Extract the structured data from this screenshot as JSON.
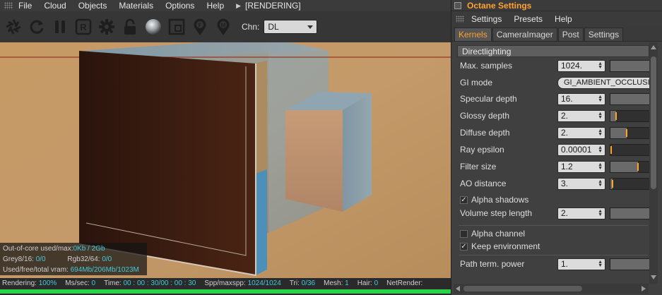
{
  "viewer": {
    "menu": [
      "File",
      "Cloud",
      "Objects",
      "Materials",
      "Options",
      "Help"
    ],
    "rendering_label": "[RENDERING]",
    "toolbar_icons": [
      "aperture-icon",
      "refresh-icon",
      "pause-icon",
      "region-render-icon",
      "settings-gear-icon",
      "lock-icon",
      "material-ball-icon",
      "viewport-resolution-icon",
      "focus-pin-icon",
      "material-pin-icon"
    ],
    "channel_label": "Chn:",
    "channel_value": "DL",
    "stats": {
      "ooc_label": "Out-of-core used/max:",
      "ooc_value": "0Kb / 2Gb",
      "grey_label": "Grey8/16:",
      "grey_value": "0/0",
      "rgb_label": "Rgb32/64:",
      "rgb_value": "0/0",
      "vram_label": "Used/free/total vram:",
      "vram_value": "694Mb/206Mb/1023M"
    },
    "status": {
      "rendering_label": "Rendering:",
      "rendering_value": "100%",
      "ms_label": "Ms/sec:",
      "ms_value": "0",
      "time_label": "Time:",
      "time_value": "00 : 00 : 30/00 : 00 : 30",
      "spp_label": "Spp/maxspp:",
      "spp_value": "1024/1024",
      "tri_label": "Tri:",
      "tri_value": "0/36",
      "mesh_label": "Mesh:",
      "mesh_value": "1",
      "hair_label": "Hair:",
      "hair_value": "0",
      "netrender_label": "NetRender:"
    },
    "progress_percent": 100,
    "colors": {
      "progress": "#2bd148",
      "stat_value": "#44c8d8",
      "accent": "#ffa232"
    }
  },
  "settings": {
    "title": "Octane Settings",
    "menu": [
      "Settings",
      "Presets",
      "Help"
    ],
    "tabs": [
      "Kernels",
      "CameraImager",
      "Post",
      "Settings"
    ],
    "active_tab": "Kernels",
    "section": "Directlighting",
    "params": {
      "max_samples": {
        "label": "Max. samples",
        "value": "1024.",
        "slider_fraction": 0.0
      },
      "gi_mode": {
        "label": "GI mode",
        "value": "GI_AMBIENT_OCCLUSION"
      },
      "specular_depth": {
        "label": "Specular depth",
        "value": "16.",
        "slider_fraction": 0.0
      },
      "glossy_depth": {
        "label": "Glossy depth",
        "value": "2.",
        "slider_fraction": 0.13
      },
      "diffuse_depth": {
        "label": "Diffuse depth",
        "value": "2.",
        "slider_fraction": 0.4
      },
      "ray_epsilon": {
        "label": "Ray epsilon",
        "value": "0.00001",
        "slider_fraction": 0.0
      },
      "filter_size": {
        "label": "Filter size",
        "value": "1.2",
        "slider_fraction": 0.68
      },
      "ao_distance": {
        "label": "AO distance",
        "value": "3.",
        "slider_fraction": 0.05
      },
      "alpha_shadows": {
        "label": "Alpha shadows",
        "checked": true
      },
      "volume_step_length": {
        "label": "Volume step length",
        "value": "2.",
        "slider_fraction": 0.0
      },
      "alpha_channel": {
        "label": "Alpha channel",
        "checked": false
      },
      "keep_environment": {
        "label": "Keep environment",
        "checked": true
      },
      "path_term_power": {
        "label": "Path term. power",
        "value": "1.",
        "slider_fraction": 0.0
      }
    }
  }
}
